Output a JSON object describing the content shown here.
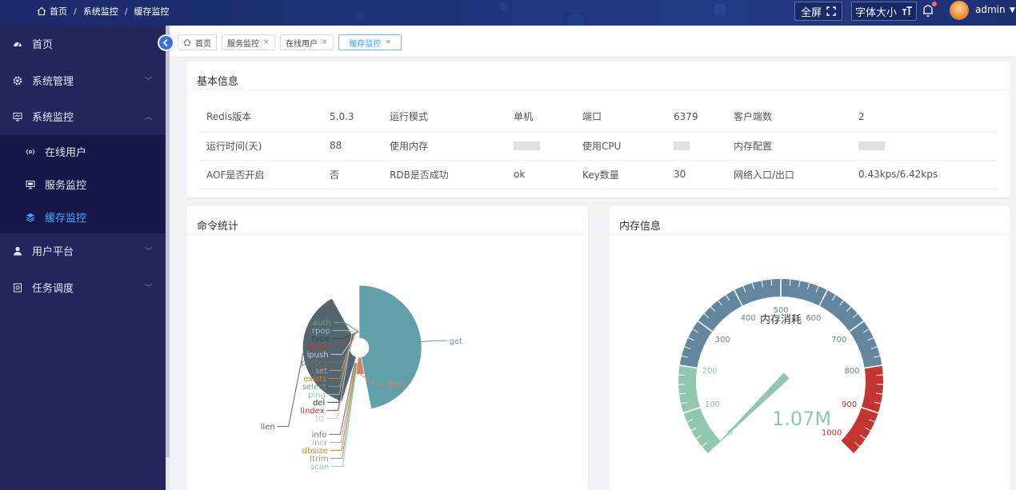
{
  "header": {
    "breadcrumb": [
      "首页",
      "系统监控",
      "缓存监控"
    ],
    "fullscreen_label": "全屏",
    "fontsize_label": "字体大小",
    "username": "admin"
  },
  "sidebar": {
    "items": [
      {
        "label": "首页",
        "icon": "dashboard-icon"
      },
      {
        "label": "系统管理",
        "icon": "gear-icon"
      },
      {
        "label": "系统监控",
        "icon": "monitor-icon"
      },
      {
        "label": "用户平台",
        "icon": "user-icon"
      },
      {
        "label": "任务调度",
        "icon": "schedule-icon"
      }
    ],
    "monitor_sub": [
      {
        "label": "在线用户",
        "icon": "online-icon"
      },
      {
        "label": "服务监控",
        "icon": "server-icon"
      },
      {
        "label": "缓存监控",
        "icon": "layers-icon",
        "active": true
      }
    ]
  },
  "tabs": [
    {
      "label": "首页",
      "closable": false
    },
    {
      "label": "服务监控",
      "closable": true
    },
    {
      "label": "在线用户",
      "closable": true
    },
    {
      "label": "缓存监控",
      "closable": true,
      "active": true
    }
  ],
  "basic_info": {
    "title": "基本信息",
    "rows": [
      [
        {
          "label": "Redis版本",
          "value": "5.0.3"
        },
        {
          "label": "运行模式",
          "value": "单机"
        },
        {
          "label": "端口",
          "value": "6379"
        },
        {
          "label": "客户端数",
          "value": "2"
        }
      ],
      [
        {
          "label": "运行时间(天)",
          "value": "88"
        },
        {
          "label": "使用内存",
          "value": ""
        },
        {
          "label": "使用CPU",
          "value": ""
        },
        {
          "label": "内存配置",
          "value": ""
        }
      ],
      [
        {
          "label": "AOF是否开启",
          "value": "否"
        },
        {
          "label": "RDB是否成功",
          "value": "ok"
        },
        {
          "label": "Key数量",
          "value": "30"
        },
        {
          "label": "网络入口/出口",
          "value": "0.43kps/6.42kps"
        }
      ]
    ]
  },
  "command_stats": {
    "title": "命令统计"
  },
  "memory_info": {
    "title": "内存信息"
  },
  "chart_data": [
    {
      "type": "pie",
      "variant": "rose",
      "center_label": "",
      "categories": [
        "get",
        "keys",
        "scan",
        "ltrim",
        "dbsize",
        "incr",
        "info",
        "llen",
        "ttl",
        "lindex",
        "del",
        "ping",
        "select",
        "exists",
        "set",
        "psetex",
        "lpush",
        "setex",
        "type",
        "rpop",
        "auth"
      ],
      "values": [
        38,
        4,
        0.5,
        0.5,
        0.5,
        0.5,
        0.5,
        30,
        0.5,
        0.5,
        0.5,
        0.5,
        0.5,
        0.5,
        0.5,
        0.5,
        0.5,
        0.5,
        0.5,
        0.5,
        0.5
      ],
      "colors": {
        "get": "#61a0a8",
        "keys": "#d48265",
        "llen": "#546570",
        "small": [
          "#91c7ae",
          "#749f83",
          "#ca8622",
          "#bda29a",
          "#6e7074",
          "#c4ccd3",
          "#c23531",
          "#2f4554"
        ]
      }
    },
    {
      "type": "gauge",
      "min": 0,
      "max": 1000,
      "ticks": [
        0,
        100,
        200,
        300,
        400,
        500,
        600,
        700,
        800,
        900,
        1000
      ],
      "value": 1.07,
      "value_label": "1.07M",
      "title": "内存消耗",
      "bands": [
        {
          "to": 0.2,
          "color": "#91c7ae"
        },
        {
          "to": 0.8,
          "color": "#63869e"
        },
        {
          "to": 1.0,
          "color": "#c23531"
        }
      ]
    }
  ]
}
